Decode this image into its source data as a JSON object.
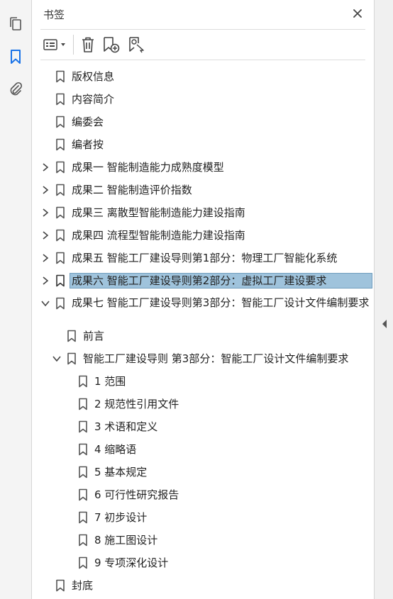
{
  "panel": {
    "title": "书签"
  },
  "rail": {
    "icons": [
      "pages-icon",
      "bookmark-icon",
      "attachment-icon"
    ],
    "accent": "#1a73e8"
  },
  "bookmarks": [
    {
      "label": "版权信息",
      "level": 0,
      "expander": "none"
    },
    {
      "label": "内容简介",
      "level": 0,
      "expander": "none"
    },
    {
      "label": "编委会",
      "level": 0,
      "expander": "none"
    },
    {
      "label": "编者按",
      "level": 0,
      "expander": "none"
    },
    {
      "label": "成果一 智能制造能力成熟度模型",
      "level": 0,
      "expander": "collapsed"
    },
    {
      "label": "成果二 智能制造评价指数",
      "level": 0,
      "expander": "collapsed"
    },
    {
      "label": "成果三 离散型智能制造能力建设指南",
      "level": 0,
      "expander": "collapsed"
    },
    {
      "label": "成果四 流程型智能制造能力建设指南",
      "level": 0,
      "expander": "collapsed"
    },
    {
      "label": "成果五 智能工厂建设导则第1部分：物理工厂智能化系统",
      "level": 0,
      "expander": "collapsed"
    },
    {
      "label": "成果六 智能工厂建设导则第2部分：虚拟工厂建设要求",
      "level": 0,
      "expander": "collapsed",
      "selected": true
    },
    {
      "label": "成果七 智能工厂建设导则第3部分：智能工厂设计文件编制要求",
      "level": 0,
      "expander": "expanded",
      "wrap": true
    },
    {
      "label": "前言",
      "level": 1,
      "expander": "none"
    },
    {
      "label": "智能工厂建设导则 第3部分：智能工厂设计文件编制要求",
      "level": 1,
      "expander": "expanded"
    },
    {
      "label": "1 范围",
      "level": 2,
      "expander": "none"
    },
    {
      "label": "2 规范性引用文件",
      "level": 2,
      "expander": "none"
    },
    {
      "label": "3 术语和定义",
      "level": 2,
      "expander": "none"
    },
    {
      "label": "4 缩略语",
      "level": 2,
      "expander": "none"
    },
    {
      "label": "5 基本规定",
      "level": 2,
      "expander": "none"
    },
    {
      "label": "6 可行性研究报告",
      "level": 2,
      "expander": "none"
    },
    {
      "label": "7 初步设计",
      "level": 2,
      "expander": "none"
    },
    {
      "label": "8 施工图设计",
      "level": 2,
      "expander": "none"
    },
    {
      "label": "9 专项深化设计",
      "level": 2,
      "expander": "none"
    },
    {
      "label": "封底",
      "level": 0,
      "expander": "none"
    }
  ]
}
